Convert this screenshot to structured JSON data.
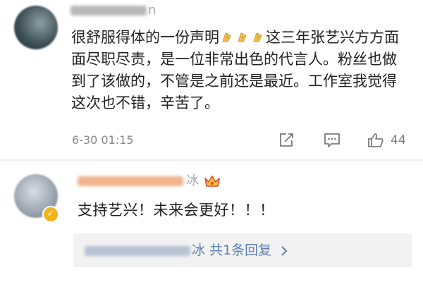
{
  "comments": [
    {
      "username_visible_part": "n",
      "text_line1_prefix": "很舒服得体的一份声明",
      "text_line1_suffix": "这三年张艺兴",
      "text_rest": "方方面面尽职尽责，是一位非常出色的代言人。粉丝也做到了该做的，不管是之前还是最近。工作室我觉得这次也不错，辛苦了。",
      "emoji_icon": "clapping-hands-emoji",
      "timestamp": "6-30 01:15",
      "actions": {
        "share_icon": "share-icon",
        "comment_icon": "comment-icon",
        "like_icon": "thumbs-up-icon",
        "like_count": "44"
      }
    },
    {
      "username_visible_part": "冰",
      "badge_icon": "crown-badge-icon",
      "verified_icon": "verified-badge-icon",
      "text": "支持艺兴！未来会更好！！！",
      "reply_link": {
        "name_visible_part": "冰",
        "label": "共1条回复"
      }
    }
  ],
  "colors": {
    "text": "#222222",
    "muted": "#888888",
    "link": "#5d7fb0",
    "reply_bg": "#f2f2f2",
    "verified": "#f2b41b"
  }
}
